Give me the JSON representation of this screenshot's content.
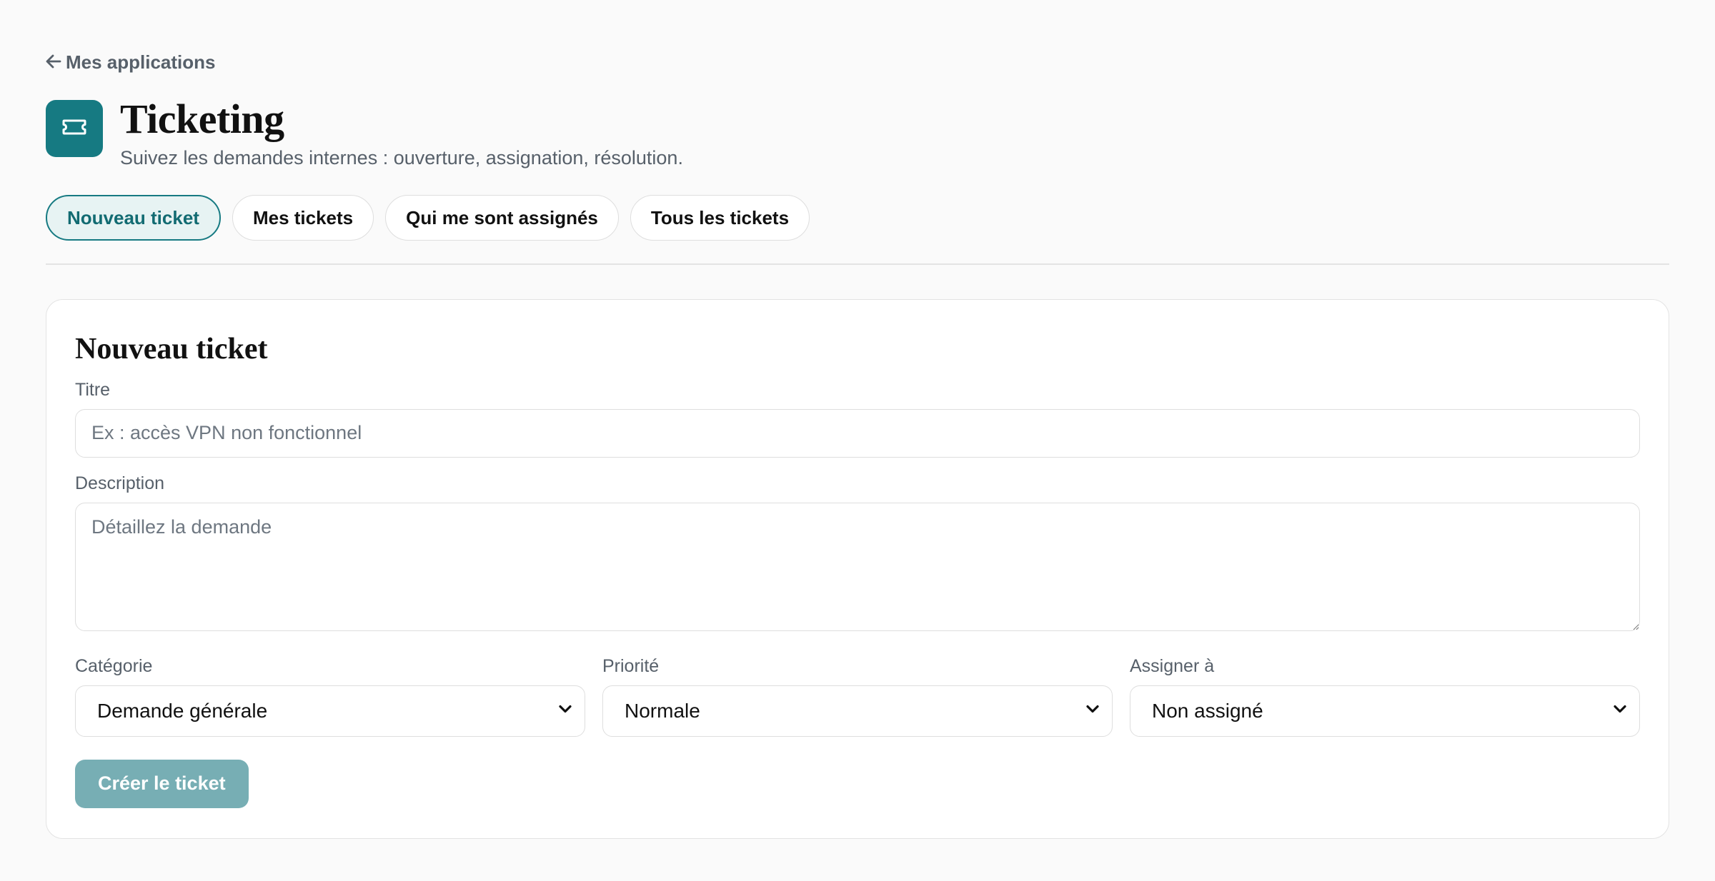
{
  "nav": {
    "back_label": "Mes applications"
  },
  "app": {
    "title": "Ticketing",
    "subtitle": "Suivez les demandes internes : ouverture, assignation, résolution.",
    "icon": "ticket-icon",
    "accent_color": "#167a82"
  },
  "tabs": [
    {
      "label": "Nouveau ticket",
      "active": true
    },
    {
      "label": "Mes tickets",
      "active": false
    },
    {
      "label": "Qui me sont assignés",
      "active": false
    },
    {
      "label": "Tous les tickets",
      "active": false
    }
  ],
  "form": {
    "title": "Nouveau ticket",
    "title_field": {
      "label": "Titre",
      "value": "",
      "placeholder": "Ex : accès VPN non fonctionnel"
    },
    "description_field": {
      "label": "Description",
      "value": "",
      "placeholder": "Détaillez la demande"
    },
    "category": {
      "label": "Catégorie",
      "selected": "Demande générale"
    },
    "priority": {
      "label": "Priorité",
      "selected": "Normale"
    },
    "assignee": {
      "label": "Assigner à",
      "selected": "Non assigné"
    },
    "submit_label": "Créer le ticket",
    "submit_color": "#77aeb4"
  }
}
